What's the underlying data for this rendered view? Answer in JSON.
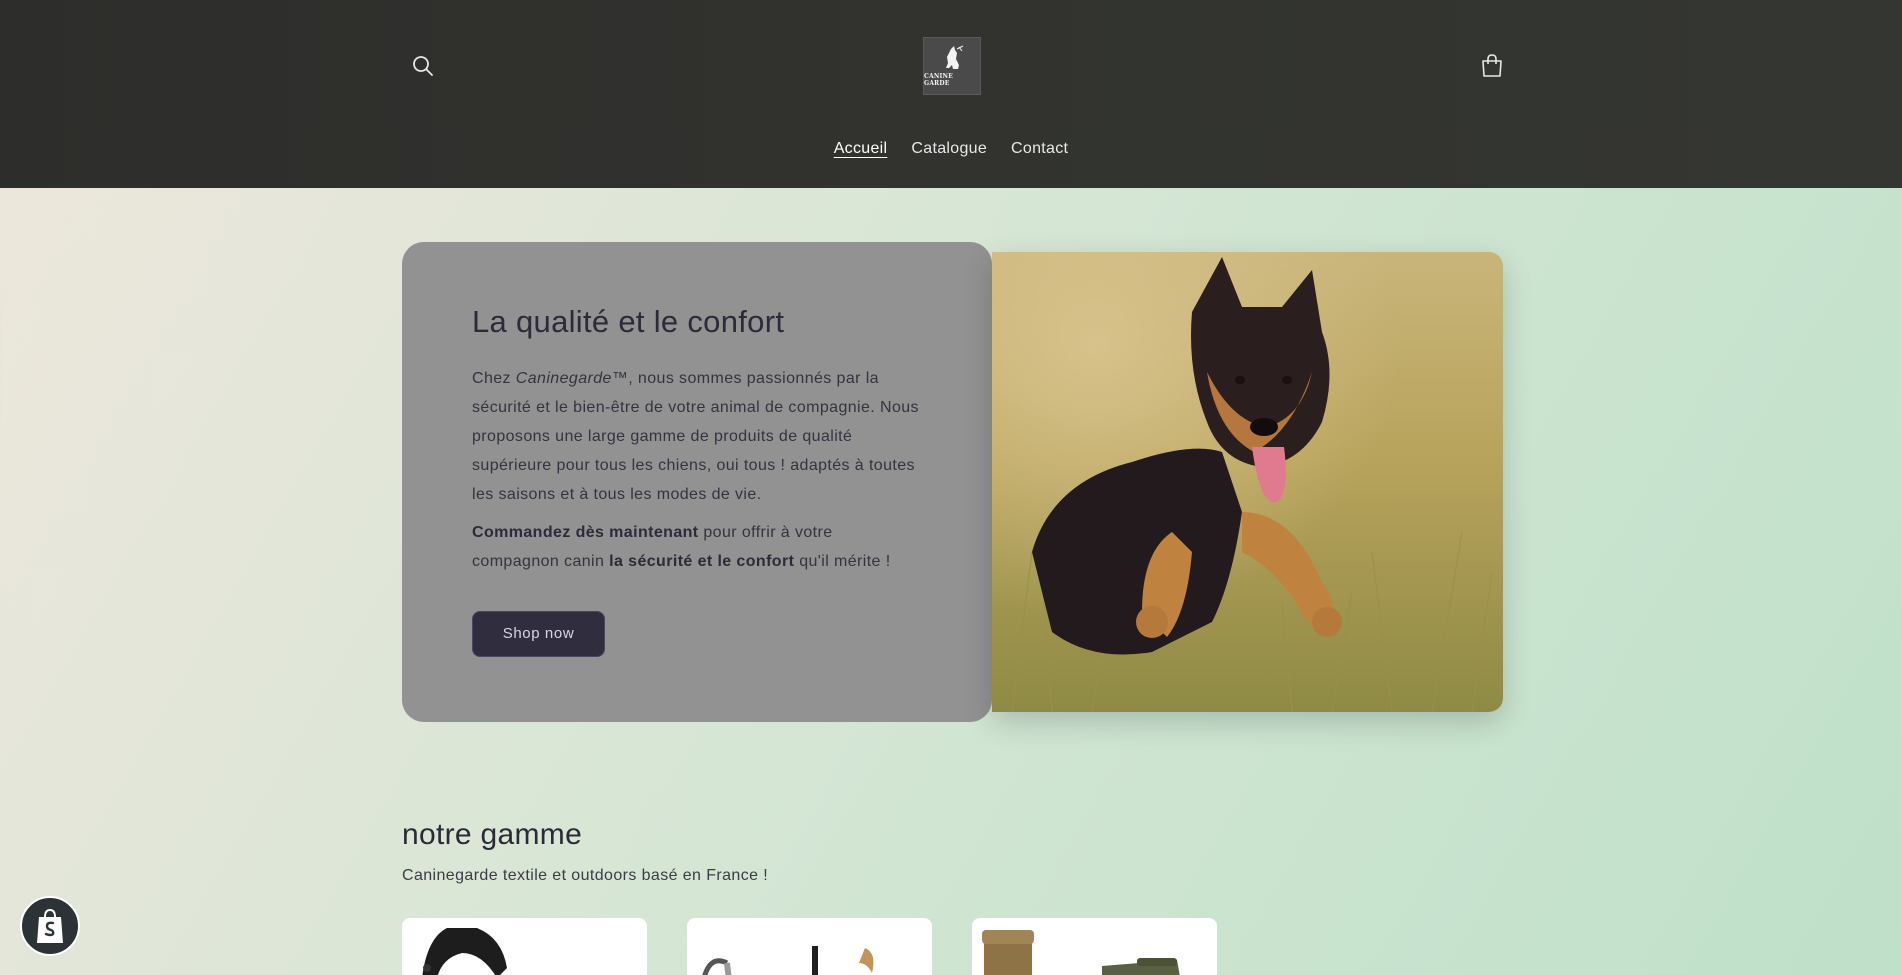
{
  "header": {
    "logo_text": "CANINE GARDE",
    "nav": [
      {
        "label": "Accueil",
        "active": true
      },
      {
        "label": "Catalogue",
        "active": false
      },
      {
        "label": "Contact",
        "active": false
      }
    ],
    "icons": {
      "search": "search-icon",
      "cart": "cart-icon"
    }
  },
  "hero": {
    "title": "La qualité et le confort",
    "p1_a": "Chez ",
    "p1_brand": "Caninegarde",
    "p1_b": "™, nous sommes passionnés par la sécurité et le bien-être de votre animal de compagnie. Nous proposons une large gamme de produits de qualité supérieure pour tous les chiens, oui tous ! adaptés à toutes les saisons et à tous les modes de vie.",
    "p2_bold1": "Commandez dès maintenant",
    "p2_text1": " pour offrir à votre compagnon canin ",
    "p2_bold2": "la sécurité et le confort",
    "p2_text2": " qu'il mérite !",
    "button": "Shop now"
  },
  "section": {
    "title": "notre gamme",
    "subtitle": "Caninegarde textile et outdoors basé en France !"
  },
  "colors": {
    "header_bg": "#2f302d",
    "hero_card_bg": "#929293",
    "button_bg": "#302d3f",
    "text_dark": "#2b2a36"
  }
}
